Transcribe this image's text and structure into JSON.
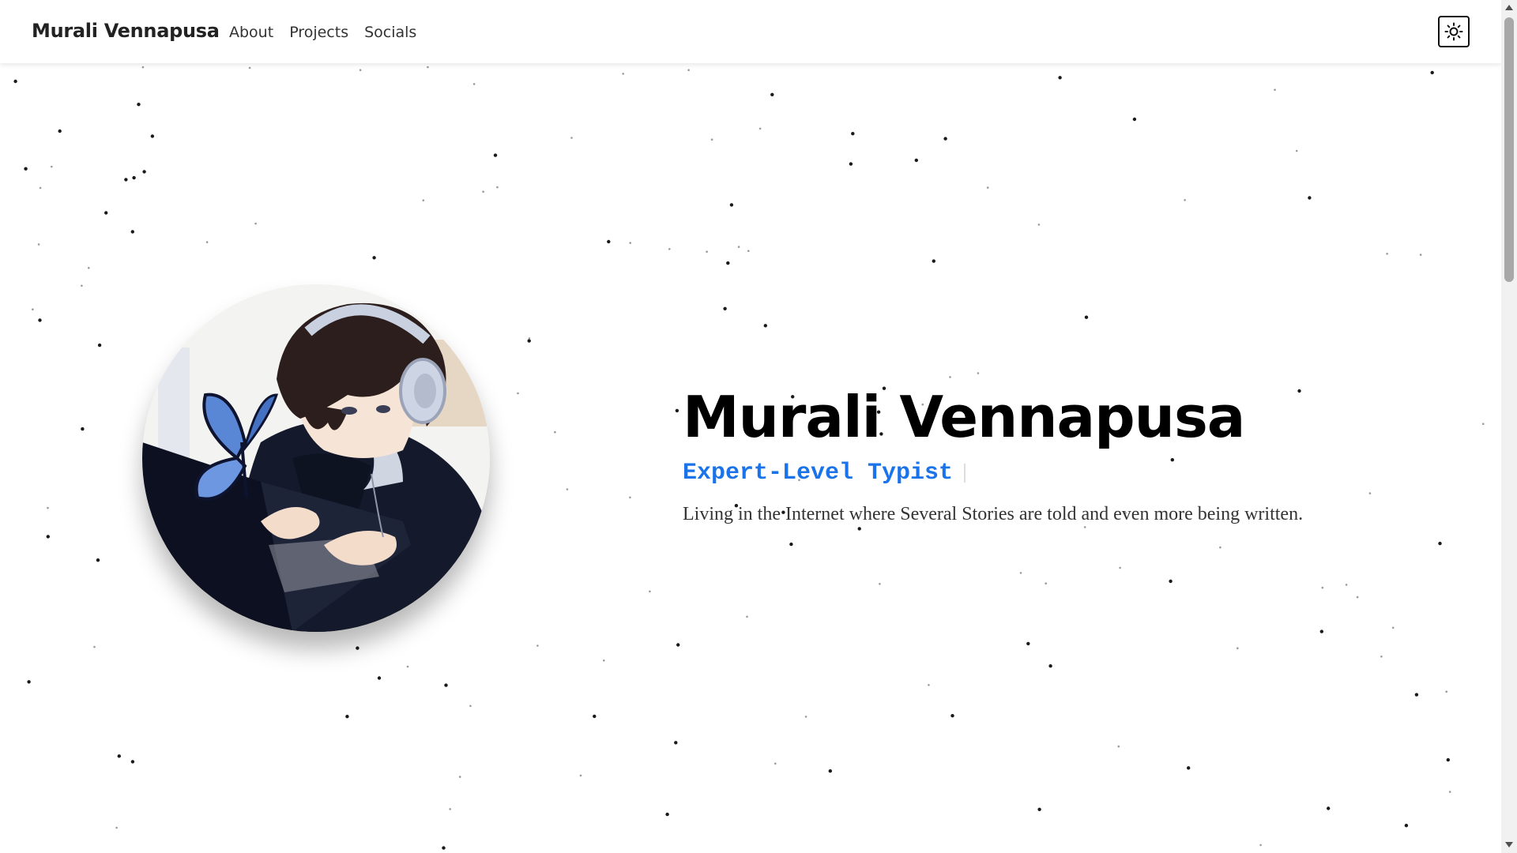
{
  "navbar": {
    "brand": "Murali Vennapusa",
    "links": [
      "About",
      "Projects",
      "Socials"
    ],
    "theme_toggle_icon": "sun-icon"
  },
  "hero": {
    "name": "Murali Vennapusa",
    "role": "Expert-Level Typist",
    "tagline": "Living in the Internet where Several Stories are told and even more being written.",
    "avatar_icon": "avatar-illustration"
  },
  "colors": {
    "accent": "#1a73e8",
    "text": "#000000",
    "background": "#ffffff"
  }
}
